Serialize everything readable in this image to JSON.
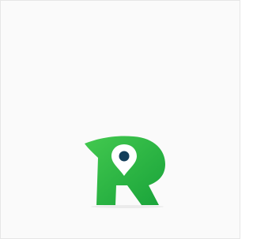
{
  "canvas": {
    "background": "#fafafa",
    "border_color": "#e6e6e6"
  },
  "logo": {
    "kind": "letter-R-with-map-pin",
    "letter": "R",
    "colors": {
      "gradient_light": "#43c94f",
      "gradient_dark": "#19a33a",
      "pin": "#ffffff",
      "pin_dot": "#133e5a"
    }
  }
}
